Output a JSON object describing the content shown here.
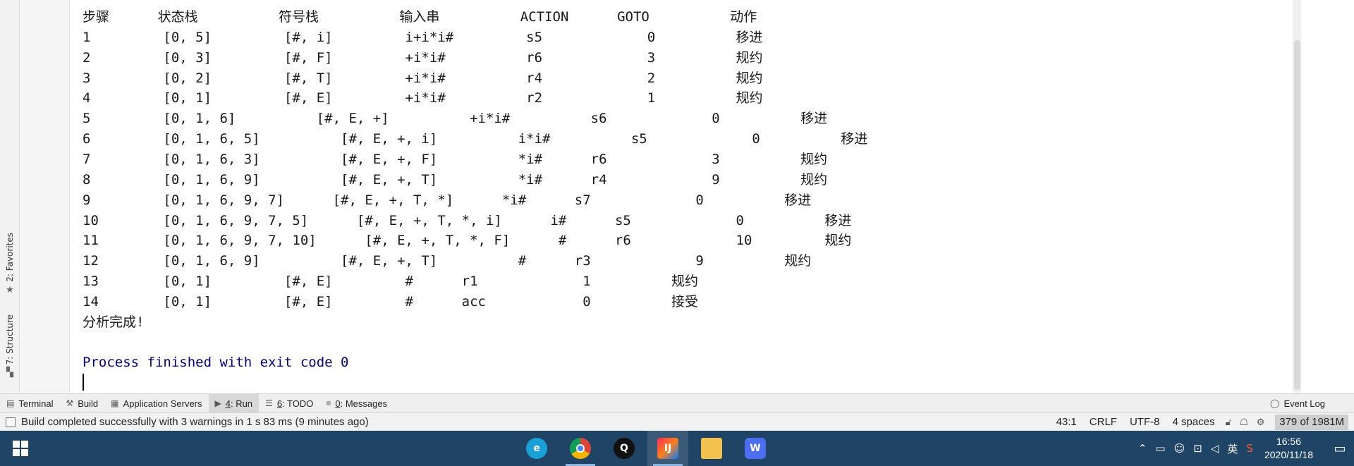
{
  "left_strip": {
    "favorites_label": "2: Favorites",
    "structure_label": "7: Structure",
    "favorites_icon": "star-icon",
    "structure_icon": "structure-icon"
  },
  "console": {
    "header": "步骤      状态栈          符号栈          输入串          ACTION      GOTO          动作",
    "rows": [
      "1         [0, 5]         [#, i]         i+i*i#         s5             0          移进",
      "2         [0, 3]         [#, F]         +i*i#          r6             3          规约",
      "3         [0, 2]         [#, T]         +i*i#          r4             2          规约",
      "4         [0, 1]         [#, E]         +i*i#          r2             1          规约",
      "5         [0, 1, 6]          [#, E, +]          +i*i#          s6             0          移进",
      "6         [0, 1, 6, 5]          [#, E, +, i]          i*i#          s5             0          移进",
      "7         [0, 1, 6, 3]          [#, E, +, F]          *i#      r6             3          规约",
      "8         [0, 1, 6, 9]          [#, E, +, T]          *i#      r4             9          规约",
      "9         [0, 1, 6, 9, 7]      [#, E, +, T, *]      *i#      s7             0          移进",
      "10        [0, 1, 6, 9, 7, 5]      [#, E, +, T, *, i]      i#      s5             0          移进",
      "11        [0, 1, 6, 9, 7, 10]      [#, E, +, T, *, F]      #      r6             10         规约",
      "12        [0, 1, 6, 9]          [#, E, +, T]          #      r3             9          规约",
      "13        [0, 1]         [#, E]         #      r1             1          规约",
      "14        [0, 1]         [#, E]         #      acc            0          接受"
    ],
    "done": "分析完成!",
    "exit_message": "Process finished with exit code 0"
  },
  "tool_tabs": [
    {
      "mn": "",
      "rest": "Terminal",
      "icon": "terminal-icon"
    },
    {
      "mn": "",
      "rest": "Build",
      "icon": "hammer-icon"
    },
    {
      "mn": "",
      "rest": "Application Servers",
      "icon": "server-icon"
    },
    {
      "mn": "4",
      "rest": ": Run",
      "icon": "run-icon"
    },
    {
      "mn": "6",
      "rest": ": TODO",
      "icon": "list-icon"
    },
    {
      "mn": "0",
      "rest": ": Messages",
      "icon": "messages-icon"
    }
  ],
  "event_log": "Event Log",
  "status_bar": {
    "message": "Build completed successfully with 3 warnings in 1 s 83 ms (9 minutes ago)",
    "position": "43:1",
    "line_ending": "CRLF",
    "encoding": "UTF-8",
    "indent": "4 spaces",
    "memory": "379 of 1981M"
  },
  "taskbar": {
    "apps": [
      "edge-icon",
      "chrome-icon",
      "qq-icon",
      "intellij-icon",
      "file-explorer-icon",
      "wps-icon"
    ],
    "ime": "英",
    "time": "16:56",
    "date": "2020/11/18"
  },
  "colors": {
    "exit_text": "#000080",
    "taskbar": "#1f4466",
    "active_tab": "#d8d8d8"
  }
}
